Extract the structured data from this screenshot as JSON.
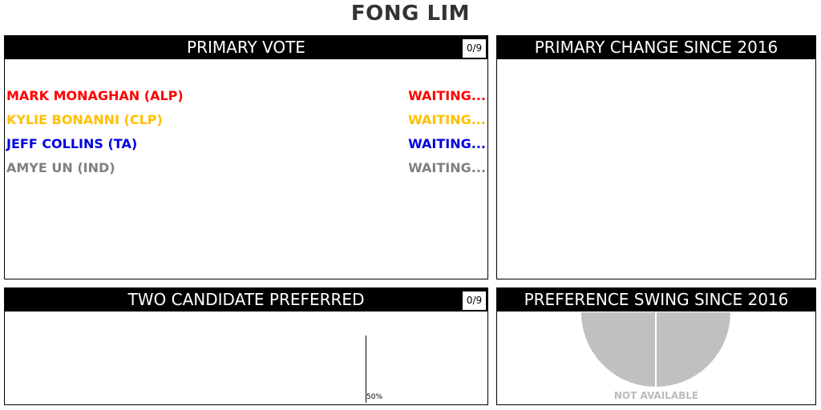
{
  "electorate": "FONG LIM",
  "colors": {
    "alp": "#ff0000",
    "clp": "#ffc000",
    "ta": "#0000dd",
    "ind": "#808080",
    "pie": "#c0c0c0",
    "na": "#bbbbbb"
  },
  "primary_vote": {
    "title": "PRIMARY VOTE",
    "counted": "0/9",
    "candidates": [
      {
        "name": "MARK MONAGHAN (ALP)",
        "status": "WAITING..."
      },
      {
        "name": "KYLIE BONANNI (CLP)",
        "status": "WAITING..."
      },
      {
        "name": "JEFF COLLINS (TA)",
        "status": "WAITING..."
      },
      {
        "name": "AMYE UN (IND)",
        "status": "WAITING..."
      }
    ]
  },
  "primary_change": {
    "title": "PRIMARY CHANGE SINCE 2016"
  },
  "two_candidate": {
    "title": "TWO CANDIDATE PREFERRED",
    "counted": "0/9",
    "midline_label": "50%"
  },
  "preference_swing": {
    "title": "PREFERENCE SWING SINCE 2016",
    "na_label": "NOT AVAILABLE"
  }
}
